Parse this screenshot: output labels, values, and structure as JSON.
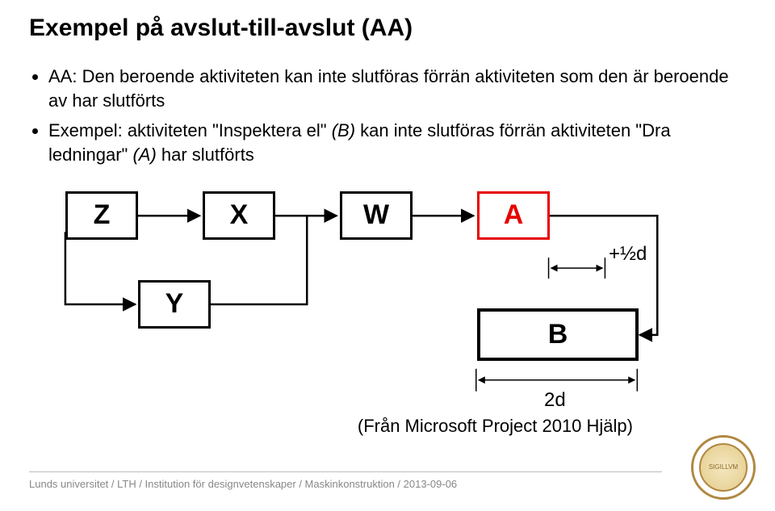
{
  "title": "Exempel på avslut-till-avslut (AA)",
  "bullets": {
    "b1_pre": "AA: Den beroende aktiviteten kan inte slutföras förrän aktiviteten som den är beroende av har slutförts",
    "b2_pre": "Exempel: aktiviteten \"Inspektera el\" ",
    "b2_i1": "(B)",
    "b2_mid": " kan inte slutföras förrän aktiviteten \"Dra ledningar\" ",
    "b2_i2": "(A)",
    "b2_post": " har slutförts"
  },
  "nodes": {
    "Z": "Z",
    "X": "X",
    "W": "W",
    "A": "A",
    "Y": "Y",
    "B": "B"
  },
  "labels": {
    "half_d": "+½d",
    "two_d": "2d"
  },
  "citation": "(Från Microsoft Project 2010 Hjälp)",
  "footer": "Lunds universitet / LTH / Institution för designvetenskaper / Maskinkonstruktion / 2013-09-06",
  "seal_text": "SIGILLVM"
}
